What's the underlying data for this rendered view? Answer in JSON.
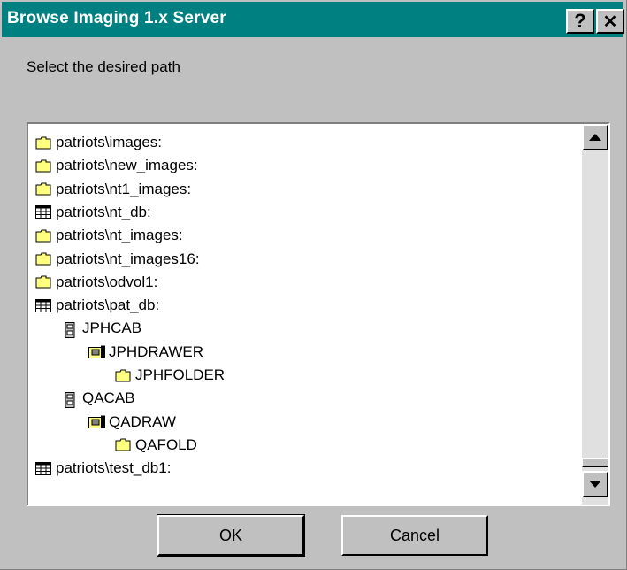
{
  "dialog": {
    "title": "Browse Imaging 1.x Server",
    "help_label": "?",
    "close_label": "✕",
    "prompt": "Select the desired path"
  },
  "tree": {
    "items": [
      {
        "label": "patriots\\images:",
        "icon": "folder-icon",
        "level": 0
      },
      {
        "label": "patriots\\new_images:",
        "icon": "folder-icon",
        "level": 0
      },
      {
        "label": "patriots\\nt1_images:",
        "icon": "folder-icon",
        "level": 0
      },
      {
        "label": "patriots\\nt_db:",
        "icon": "database-icon",
        "level": 0
      },
      {
        "label": "patriots\\nt_images:",
        "icon": "folder-icon",
        "level": 0
      },
      {
        "label": "patriots\\nt_images16:",
        "icon": "folder-icon",
        "level": 0
      },
      {
        "label": "patriots\\odvol1:",
        "icon": "folder-icon",
        "level": 0
      },
      {
        "label": "patriots\\pat_db:",
        "icon": "database-icon",
        "level": 0
      },
      {
        "label": "JPHCAB",
        "icon": "cabinet-icon",
        "level": 1
      },
      {
        "label": "JPHDRAWER",
        "icon": "drawer-icon",
        "level": 2
      },
      {
        "label": "JPHFOLDER",
        "icon": "folder-icon",
        "level": 3
      },
      {
        "label": "QACAB",
        "icon": "cabinet-icon",
        "level": 1
      },
      {
        "label": "QADRAW",
        "icon": "drawer-icon",
        "level": 2
      },
      {
        "label": "QAFOLD",
        "icon": "folder-icon",
        "level": 3
      },
      {
        "label": "patriots\\test_db1:",
        "icon": "database-icon",
        "level": 0
      }
    ]
  },
  "buttons": {
    "ok": "OK",
    "cancel": "Cancel"
  },
  "colors": {
    "titlebar": "#008080",
    "face": "#c0c0c0",
    "folder": "#ffff80"
  }
}
